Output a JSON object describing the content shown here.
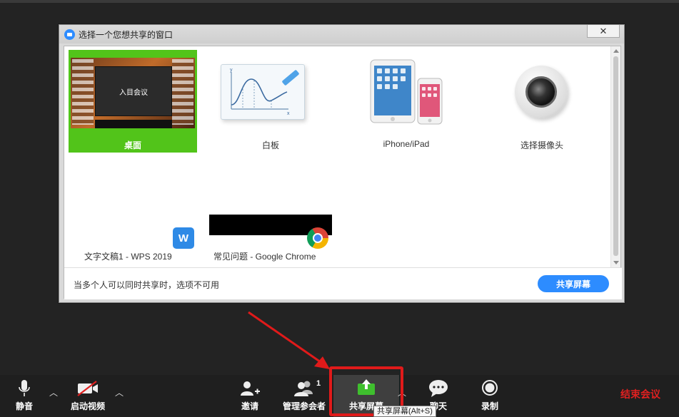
{
  "dialog": {
    "title": "选择一个您想共享的窗口",
    "close_label": "✕",
    "tiles": [
      {
        "label": "桌面",
        "selected": true
      },
      {
        "label": "白板"
      },
      {
        "label": "iPhone/iPad"
      },
      {
        "label": "选择摄像头"
      }
    ],
    "desktop_preview_text": "入目会议",
    "windows": [
      {
        "label": "文字文稿1 - WPS 2019",
        "icon": "wps-icon"
      },
      {
        "label": "常见问题 - Google Chrome",
        "icon": "chrome-icon"
      }
    ],
    "footer_note": "当多个人可以同时共享时，选项不可用",
    "share_button": "共享屏幕"
  },
  "toolbar": {
    "mute": "静音",
    "video": "启动视频",
    "invite": "邀请",
    "participants": "管理参会者",
    "participants_count": "1",
    "share": "共享屏幕",
    "chat": "聊天",
    "record": "录制",
    "end": "结束会议",
    "share_tooltip": "共享屏幕(Alt+S)"
  },
  "colors": {
    "accent": "#2d8cff",
    "selected": "#52c41a",
    "annotation": "#e01a1a",
    "end": "#e02020"
  }
}
